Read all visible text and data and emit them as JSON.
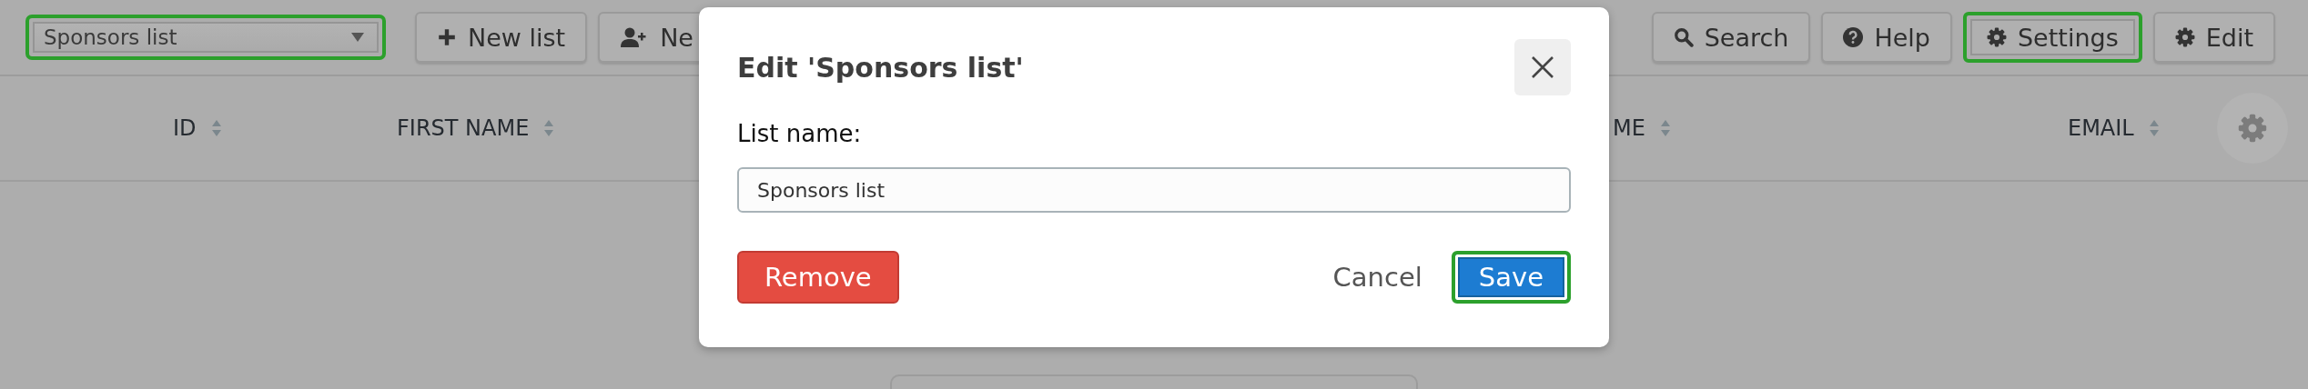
{
  "toolbar": {
    "list_select": {
      "value": "Sponsors list",
      "highlighted": true
    },
    "left_buttons": [
      {
        "label": "New list",
        "kind": "add",
        "highlighted": false
      },
      {
        "label": "Ne",
        "kind": "add-user",
        "highlighted": false
      }
    ],
    "right_buttons": [
      {
        "label": "Search",
        "kind": "search",
        "highlighted": false
      },
      {
        "label": "Help",
        "kind": "help",
        "highlighted": false
      },
      {
        "label": "Settings",
        "kind": "settings",
        "highlighted": true
      },
      {
        "label": "Edit",
        "kind": "edit",
        "highlighted": false
      }
    ]
  },
  "table": {
    "columns": [
      {
        "label": "ID"
      },
      {
        "label": "FIRST NAME"
      },
      {
        "label": "ME"
      },
      {
        "label": "EMAIL"
      }
    ]
  },
  "dialog": {
    "title": "Edit 'Sponsors list'",
    "field_label": "List name:",
    "field_value": "Sponsors list",
    "buttons": [
      {
        "label": "Remove",
        "kind": "danger",
        "highlighted": false
      },
      {
        "label": "Cancel",
        "kind": "link",
        "highlighted": false
      },
      {
        "label": "Save",
        "kind": "primary",
        "highlighted": true
      }
    ]
  }
}
